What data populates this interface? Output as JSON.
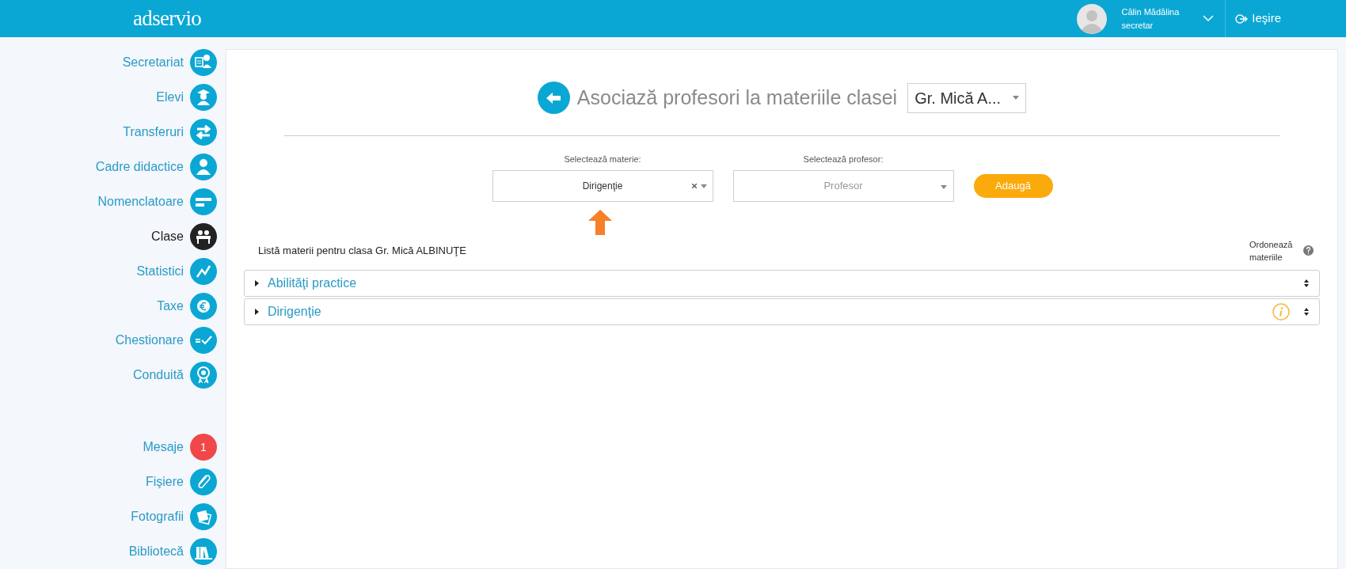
{
  "header": {
    "logo": "adservio",
    "user_name": "Călin Mădălina",
    "user_role": "secretar",
    "logout": "Ieşire"
  },
  "sidebar": {
    "items": [
      {
        "label": "Secretariat",
        "selected": false
      },
      {
        "label": "Elevi",
        "selected": false
      },
      {
        "label": "Transferuri",
        "selected": false
      },
      {
        "label": "Cadre didactice",
        "selected": false
      },
      {
        "label": "Nomenclatoare",
        "selected": false
      },
      {
        "label": "Clase",
        "selected": true
      },
      {
        "label": "Statistici",
        "selected": false
      },
      {
        "label": "Taxe",
        "selected": false
      },
      {
        "label": "Chestionare",
        "selected": false
      },
      {
        "label": "Conduită",
        "selected": false
      }
    ],
    "items_2": [
      {
        "label": "Mesaje",
        "selected": false,
        "badge": "1"
      },
      {
        "label": "Fişiere",
        "selected": false
      },
      {
        "label": "Fotografii",
        "selected": false
      },
      {
        "label": "Bibliotecă",
        "selected": false
      }
    ]
  },
  "page": {
    "title": "Asociază profesori la materiile clasei",
    "class_select": "Gr. Mică A...",
    "subject_label": "Selectează materie:",
    "subject_value": "Dirigenţie",
    "teacher_label": "Selectează profesor:",
    "teacher_placeholder": "Profesor",
    "add_button": "Adaugă",
    "list_title": "Listă materii pentru clasa Gr. Mică ALBINUŢE",
    "sort_label": "Ordonează materiile",
    "subjects": [
      {
        "name": "Abilităţi practice",
        "expanded": false,
        "info": false
      },
      {
        "name": "Dirigenţie",
        "expanded": false,
        "info": true
      }
    ]
  }
}
